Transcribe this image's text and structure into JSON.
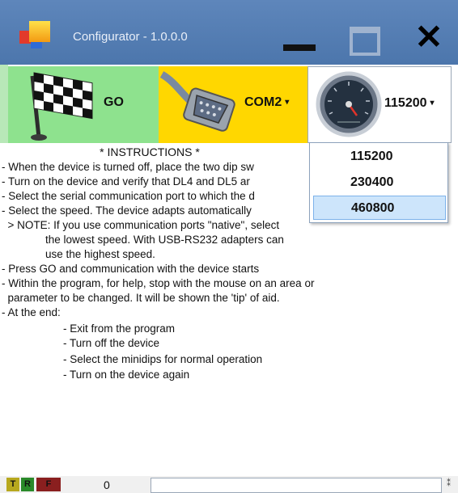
{
  "window": {
    "title": "Configurator - 1.0.0.0"
  },
  "toolbar": {
    "go_label": "GO",
    "port_label": "COM2",
    "speed_label": "115200",
    "caret": "▾"
  },
  "speed_menu": {
    "options": [
      "115200",
      "230400",
      "460800"
    ],
    "selected_index": 2
  },
  "instructions": {
    "title": "* INSTRUCTIONS *",
    "lines": [
      "- When the device is turned off, place the two dip sw",
      "- Turn on the device and verify that DL4 and DL5 ar",
      "- Select the serial communication port to which the d",
      "- Select the speed. The device adapts automatically",
      "  > NOTE: If you use communication ports \"native\", select",
      "the lowest speed. With USB-RS232 adapters can",
      "use the highest speed.",
      "- Press GO and communication with the device starts",
      "- Within the program, for help, stop with the mouse on an area or",
      "  parameter to be changed. It will be shown the 'tip' of aid.",
      "- At the end:",
      "- Exit from the program",
      "- Turn off the device",
      "- Select the minidips for normal operation",
      "- Turn on the device again"
    ]
  },
  "statusbar": {
    "t_label": "T",
    "r_label": "R",
    "f_label": "F",
    "counter": "0",
    "field_value": ""
  },
  "colors": {
    "titlebar": "#4c76ac",
    "go_bg": "#8ee28e",
    "com_bg": "#ffd700",
    "menu_highlight": "#cde5fb"
  },
  "icons": [
    "app-icon",
    "checkered-flag-icon",
    "serial-connector-icon",
    "gauge-icon",
    "minimize-icon",
    "maximize-icon",
    "close-icon"
  ]
}
